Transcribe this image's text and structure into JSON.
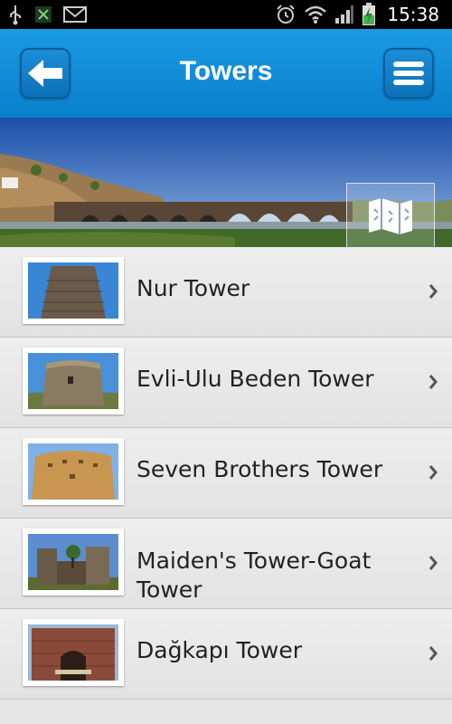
{
  "status_bar": {
    "time": "15:38",
    "icons": [
      "usb-icon",
      "x-icon",
      "mail-icon",
      "alarm-icon",
      "wifi-icon",
      "signal-icon",
      "battery-charging-icon"
    ]
  },
  "header": {
    "title": "Towers",
    "back_icon": "arrow-left-icon",
    "menu_icon": "menu-icon"
  },
  "banner": {
    "map_icon": "map-icon"
  },
  "towers": [
    {
      "name": "Nur Tower"
    },
    {
      "name": "Evli-Ulu Beden Tower"
    },
    {
      "name": "Seven Brothers Tower"
    },
    {
      "name": "Maiden's Tower-Goat Tower"
    },
    {
      "name": "Dağkapı Tower"
    }
  ],
  "colors": {
    "header": "#0a8ad8",
    "list_bg": "#e6e6e6",
    "text": "#222222"
  }
}
